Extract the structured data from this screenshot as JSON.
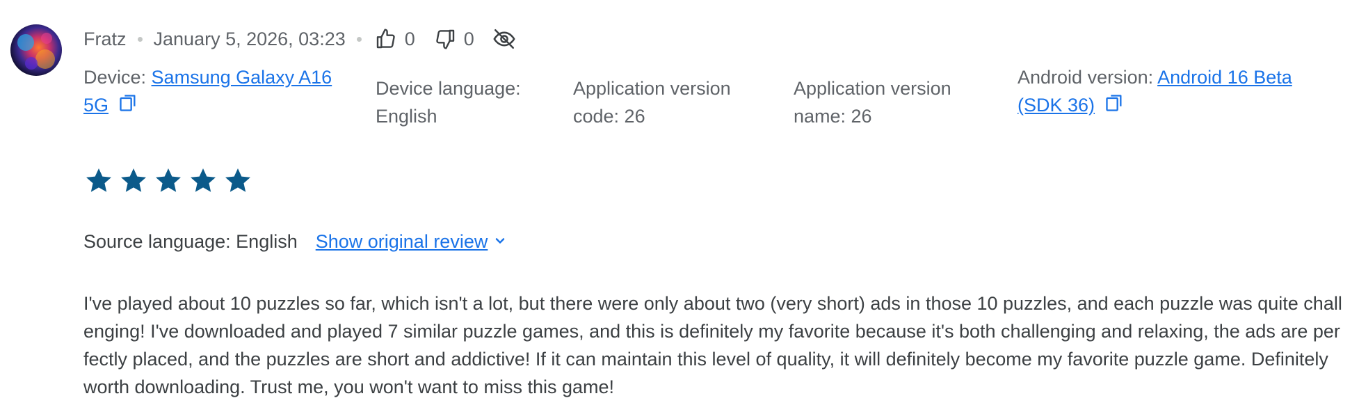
{
  "review": {
    "author": "Fratz",
    "date": "January 5, 2026, 03:23",
    "thumbs_up_count": "0",
    "thumbs_down_count": "0",
    "device_label": "Device: ",
    "device_link": "Samsung Galaxy A16 5G",
    "device_language": "Device language: English",
    "app_version_code": "Application version code: 26",
    "app_version_name": "Application version name: 26",
    "android_label": "Android version: ",
    "android_link": "Android 16 Beta (SDK 36)",
    "rating": 5,
    "rating_max": 5,
    "source_language": "Source language: English",
    "show_original": "Show original review",
    "text": "I've played about 10 puzzles so far, which isn't a lot, but there were only about two (very short) ads in those 10 puzzles, and each puzzle was quite challenging! I've downloaded and played 7 similar puzzle games, and this is definitely my favorite because it's both challenging and relaxing, the ads are perfectly placed, and the puzzles are short and addictive! If it can maintain this level of quality, it will definitely become my favorite puzzle game. Definitely worth downloading. Trust me, you won't want to miss this game!"
  },
  "icons": {
    "thumbs_up": "thumbs-up-icon",
    "thumbs_down": "thumbs-down-icon",
    "hide": "visibility-off-icon",
    "copy": "copy-icon",
    "star": "star-icon",
    "chevron": "chevron-down-icon"
  },
  "colors": {
    "link": "#1a73e8",
    "star": "#0b5a8a",
    "text": "#3c4043",
    "muted": "#5f6368"
  }
}
